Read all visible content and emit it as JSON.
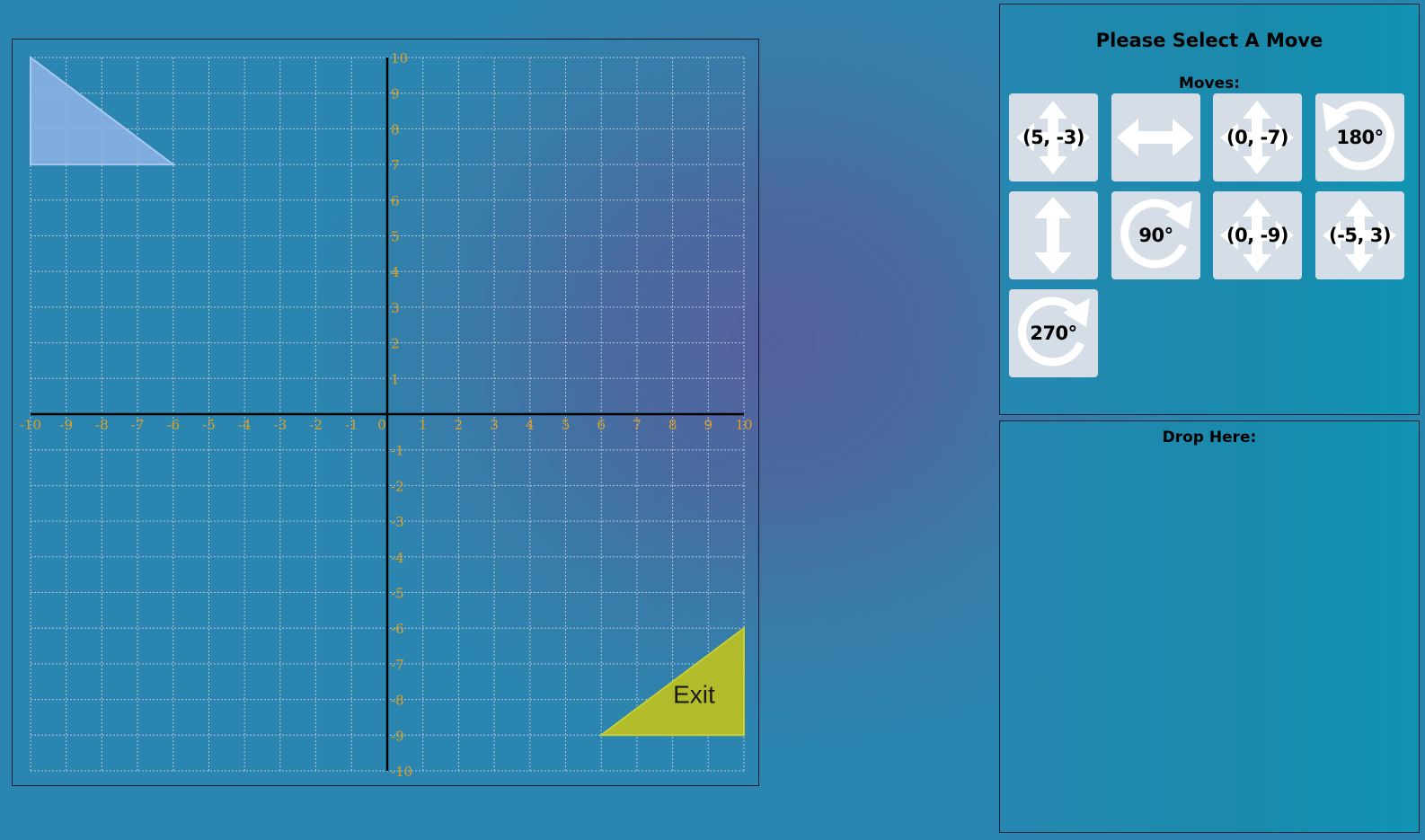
{
  "board": {
    "x_min": -10,
    "x_max": 10,
    "y_min": -10,
    "y_max": 10,
    "grid": true,
    "axis_color": "#000000",
    "label_color": "#e0a020",
    "player_shape": {
      "vertices": [
        [
          -10,
          10
        ],
        [
          -10,
          7
        ],
        [
          -6,
          7
        ]
      ],
      "color": "#8fb4e8"
    },
    "exit_shape": {
      "vertices": [
        [
          10,
          -6
        ],
        [
          10,
          -9
        ],
        [
          6,
          -9
        ]
      ],
      "color": "#b2bb2a",
      "label": "Exit"
    }
  },
  "panel": {
    "title": "Please Select A Move",
    "moves_label": "Moves:",
    "drop_label": "Drop Here:"
  },
  "moves": [
    {
      "type": "translate",
      "label": "(5, -3)",
      "icon": "four-way-arrow-icon"
    },
    {
      "type": "reflect-horizontal",
      "label": "",
      "icon": "horizontal-arrow-icon"
    },
    {
      "type": "translate",
      "label": "(0, -7)",
      "icon": "four-way-arrow-icon"
    },
    {
      "type": "rotate-ccw",
      "label": "180°",
      "icon": "rotate-ccw-icon"
    },
    {
      "type": "reflect-vertical",
      "label": "",
      "icon": "vertical-arrow-icon"
    },
    {
      "type": "rotate-cw",
      "label": "90°",
      "icon": "rotate-cw-icon"
    },
    {
      "type": "translate",
      "label": "(0, -9)",
      "icon": "four-way-arrow-icon"
    },
    {
      "type": "translate",
      "label": "(-5, 3)",
      "icon": "four-way-arrow-icon"
    },
    {
      "type": "rotate-cw",
      "label": "270°",
      "icon": "rotate-cw-icon"
    }
  ]
}
